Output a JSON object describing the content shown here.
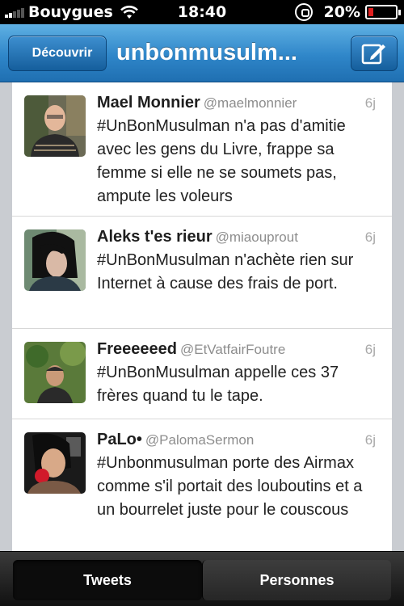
{
  "status_bar": {
    "carrier": "Bouygues",
    "time": "18:40",
    "battery": "20%",
    "battery_level": 0.2
  },
  "nav": {
    "back_label": "Découvrir",
    "title": "unbonmusulm..."
  },
  "tweets": [
    {
      "name": "Mael Monnier",
      "handle": "@maelmonnier",
      "time": "6j",
      "text": "#UnBonMusulman n'a pas d'amitie avec les gens du Livre, frappe sa femme si elle ne se soumets pas, ampute les voleurs"
    },
    {
      "name": "Aleks t'es rieur",
      "handle": "@miaouprout",
      "time": "6j",
      "text": "#UnBonMusulman n'achète rien sur Internet à cause des frais de port."
    },
    {
      "name": "Freeeeeed",
      "handle": "@EtVatfairFoutre",
      "time": "6j",
      "text": "#UnBonMusulman appelle ces 37 frères quand tu le tape."
    },
    {
      "name": "PaLo•",
      "handle": "@PalomaSermon",
      "time": "6j",
      "text": "#Unbonmusulman porte des Airmax comme s'il portait des louboutins et a un bourrelet juste pour le couscous"
    }
  ],
  "tabs": {
    "tweets": "Tweets",
    "personnes": "Personnes"
  }
}
